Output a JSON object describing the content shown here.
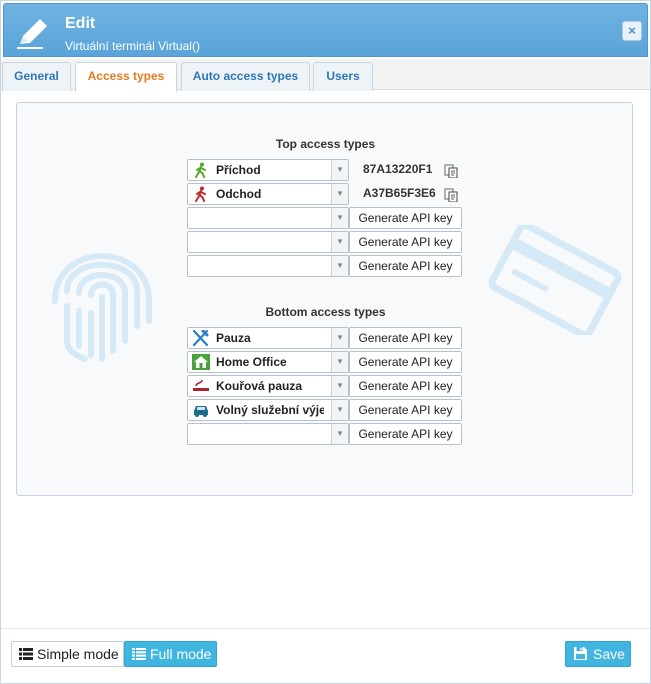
{
  "header": {
    "title": "Edit",
    "subtitle": "Virtuální terminál Virtual()",
    "close_glyph": "×"
  },
  "tabs": [
    {
      "label": "General",
      "active": false
    },
    {
      "label": "Access types",
      "active": true
    },
    {
      "label": "Auto access types",
      "active": false
    },
    {
      "label": "Users",
      "active": false
    }
  ],
  "top": {
    "title": "Top access types",
    "rows": [
      {
        "label": "Příchod",
        "icon": "walking-person-green-icon",
        "code": "87A13220F1"
      },
      {
        "label": "Odchod",
        "icon": "walking-person-red-icon",
        "code": "A37B65F3E6"
      },
      {
        "label": "",
        "button": "Generate API key"
      },
      {
        "label": "",
        "button": "Generate API key"
      },
      {
        "label": "",
        "button": "Generate API key"
      }
    ]
  },
  "bottom": {
    "title": "Bottom access types",
    "rows": [
      {
        "label": "Pauza",
        "icon": "fork-knife-icon",
        "button": "Generate API key"
      },
      {
        "label": "Home Office",
        "icon": "house-icon",
        "button": "Generate API key"
      },
      {
        "label": "Kouřová pauza",
        "icon": "cigarette-icon",
        "button": "Generate API key"
      },
      {
        "label": "Volný služební výjezd",
        "icon": "car-icon",
        "button": "Generate API key"
      },
      {
        "label": "",
        "button": "Generate API key"
      }
    ]
  },
  "footer": {
    "simple_mode": "Simple mode",
    "full_mode": "Full mode",
    "save": "Save"
  },
  "colors": {
    "header": "#5aa4d9",
    "active_tab_text": "#e27b1e",
    "tab_text": "#2f78b5",
    "button_primary": "#3fb5e0"
  }
}
